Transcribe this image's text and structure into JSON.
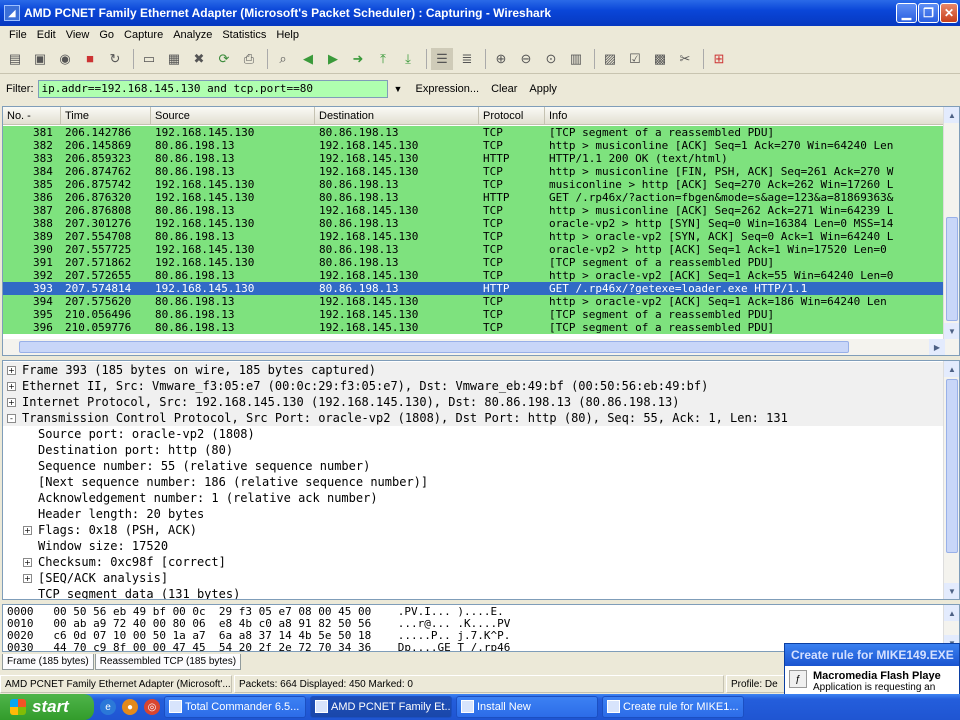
{
  "window": {
    "title": "AMD PCNET Family Ethernet Adapter (Microsoft's Packet Scheduler) : Capturing - Wireshark"
  },
  "menu": [
    "File",
    "Edit",
    "View",
    "Go",
    "Capture",
    "Analyze",
    "Statistics",
    "Help"
  ],
  "filter": {
    "label": "Filter:",
    "value": "ip.addr==192.168.145.130 and tcp.port==80",
    "expression": "Expression...",
    "clear": "Clear",
    "apply": "Apply"
  },
  "packet_list": {
    "columns": [
      "No. -",
      "Time",
      "Source",
      "Destination",
      "Protocol",
      "Info"
    ],
    "rows": [
      {
        "no": "381",
        "time": "206.142786",
        "src": "192.168.145.130",
        "dst": "80.86.198.13",
        "proto": "TCP",
        "info": "[TCP segment of a reassembled PDU]"
      },
      {
        "no": "382",
        "time": "206.145869",
        "src": "80.86.198.13",
        "dst": "192.168.145.130",
        "proto": "TCP",
        "info": "http > musiconline [ACK] Seq=1 Ack=270 Win=64240 Len"
      },
      {
        "no": "383",
        "time": "206.859323",
        "src": "80.86.198.13",
        "dst": "192.168.145.130",
        "proto": "HTTP",
        "info": "HTTP/1.1 200 OK  (text/html)"
      },
      {
        "no": "384",
        "time": "206.874762",
        "src": "80.86.198.13",
        "dst": "192.168.145.130",
        "proto": "TCP",
        "info": "http > musiconline [FIN, PSH, ACK] Seq=261 Ack=270 W"
      },
      {
        "no": "385",
        "time": "206.875742",
        "src": "192.168.145.130",
        "dst": "80.86.198.13",
        "proto": "TCP",
        "info": "musiconline > http [ACK] Seq=270 Ack=262 Win=17260 L"
      },
      {
        "no": "386",
        "time": "206.876320",
        "src": "192.168.145.130",
        "dst": "80.86.198.13",
        "proto": "HTTP",
        "info": "GET /.rp46x/?action=fbgen&mode=s&age=123&a=81869363&"
      },
      {
        "no": "387",
        "time": "206.876808",
        "src": "80.86.198.13",
        "dst": "192.168.145.130",
        "proto": "TCP",
        "info": "http > musiconline [ACK] Seq=262 Ack=271 Win=64239 L"
      },
      {
        "no": "388",
        "time": "207.301276",
        "src": "192.168.145.130",
        "dst": "80.86.198.13",
        "proto": "TCP",
        "info": "oracle-vp2 > http [SYN] Seq=0 Win=16384 Len=0 MSS=14"
      },
      {
        "no": "389",
        "time": "207.554708",
        "src": "80.86.198.13",
        "dst": "192.168.145.130",
        "proto": "TCP",
        "info": "http > oracle-vp2 [SYN, ACK] Seq=0 Ack=1 Win=64240 L"
      },
      {
        "no": "390",
        "time": "207.557725",
        "src": "192.168.145.130",
        "dst": "80.86.198.13",
        "proto": "TCP",
        "info": "oracle-vp2 > http [ACK] Seq=1 Ack=1 Win=17520 Len=0"
      },
      {
        "no": "391",
        "time": "207.571862",
        "src": "192.168.145.130",
        "dst": "80.86.198.13",
        "proto": "TCP",
        "info": "[TCP segment of a reassembled PDU]"
      },
      {
        "no": "392",
        "time": "207.572655",
        "src": "80.86.198.13",
        "dst": "192.168.145.130",
        "proto": "TCP",
        "info": "http > oracle-vp2 [ACK] Seq=1 Ack=55 Win=64240 Len=0"
      },
      {
        "no": "393",
        "time": "207.574814",
        "src": "192.168.145.130",
        "dst": "80.86.198.13",
        "proto": "HTTP",
        "info": "GET /.rp46x/?getexe=loader.exe HTTP/1.1"
      },
      {
        "no": "394",
        "time": "207.575620",
        "src": "80.86.198.13",
        "dst": "192.168.145.130",
        "proto": "TCP",
        "info": "http > oracle-vp2 [ACK] Seq=1 Ack=186 Win=64240 Len"
      },
      {
        "no": "395",
        "time": "210.056496",
        "src": "80.86.198.13",
        "dst": "192.168.145.130",
        "proto": "TCP",
        "info": "[TCP segment of a reassembled PDU]"
      },
      {
        "no": "396",
        "time": "210.059776",
        "src": "80.86.198.13",
        "dst": "192.168.145.130",
        "proto": "TCP",
        "info": "[TCP segment of a reassembled PDU]"
      }
    ],
    "selected_index": 12
  },
  "details": [
    {
      "text": "Frame 393 (185 bytes on wire, 185 bytes captured)",
      "expander": "+",
      "indent": 0
    },
    {
      "text": "Ethernet II, Src: Vmware_f3:05:e7 (00:0c:29:f3:05:e7), Dst: Vmware_eb:49:bf (00:50:56:eb:49:bf)",
      "expander": "+",
      "indent": 0
    },
    {
      "text": "Internet Protocol, Src: 192.168.145.130 (192.168.145.130), Dst: 80.86.198.13 (80.86.198.13)",
      "expander": "+",
      "indent": 0
    },
    {
      "text": "Transmission Control Protocol, Src Port: oracle-vp2 (1808), Dst Port: http (80), Seq: 55, Ack: 1, Len: 131",
      "expander": "-",
      "indent": 0
    },
    {
      "text": "Source port: oracle-vp2 (1808)",
      "expander": "",
      "indent": 1
    },
    {
      "text": "Destination port: http (80)",
      "expander": "",
      "indent": 1
    },
    {
      "text": "Sequence number: 55    (relative sequence number)",
      "expander": "",
      "indent": 1
    },
    {
      "text": "[Next sequence number: 186    (relative sequence number)]",
      "expander": "",
      "indent": 1
    },
    {
      "text": "Acknowledgement number: 1    (relative ack number)",
      "expander": "",
      "indent": 1
    },
    {
      "text": "Header length: 20 bytes",
      "expander": "",
      "indent": 1
    },
    {
      "text": "Flags: 0x18 (PSH, ACK)",
      "expander": "+",
      "indent": 1
    },
    {
      "text": "Window size: 17520",
      "expander": "",
      "indent": 1
    },
    {
      "text": "Checksum: 0xc98f [correct]",
      "expander": "+",
      "indent": 1
    },
    {
      "text": "[SEQ/ACK analysis]",
      "expander": "+",
      "indent": 1
    },
    {
      "text": "TCP segment data (131 bytes)",
      "expander": "",
      "indent": 1
    }
  ],
  "hex_rows": [
    "0000   00 50 56 eb 49 bf 00 0c  29 f3 05 e7 08 00 45 00    .PV.I... )....E.",
    "0010   00 ab a9 72 40 00 80 06  e8 4b c0 a8 91 82 50 56    ...r@... .K....PV",
    "0020   c6 0d 07 10 00 50 1a a7  6a a8 37 14 4b 5e 50 18    .....P.. j.7.K^P.",
    "0030   44 70 c9 8f 00 00 47 45  54 20 2f 2e 72 70 34 36    Dp....GE T /.rp46"
  ],
  "tabs": [
    "Frame (185 bytes)",
    "Reassembled TCP (185 bytes)"
  ],
  "status": {
    "iface": "AMD PCNET Family Ethernet Adapter (Microsoft'...",
    "counts": "Packets: 664 Displayed: 450 Marked: 0",
    "profile": "Profile: De"
  },
  "popup": {
    "title": "Create rule for MIKE149.EXE",
    "heading": "Macromedia Flash Playe",
    "text": "Application is requesting an"
  },
  "taskbar": {
    "start": "start",
    "tasks": [
      "Total Commander 6.5...",
      "AMD PCNET Family Et...",
      "Install New",
      "Create rule for MIKE1..."
    ],
    "active_index": 1
  },
  "colors": {
    "row_green": "#7ee27e",
    "row_selected": "#316ac5",
    "filter_ok": "#afffaf",
    "titlebar": "#0a46d8"
  },
  "icons": {
    "expand": "plus-box-icon",
    "collapse": "minus-box-icon"
  }
}
